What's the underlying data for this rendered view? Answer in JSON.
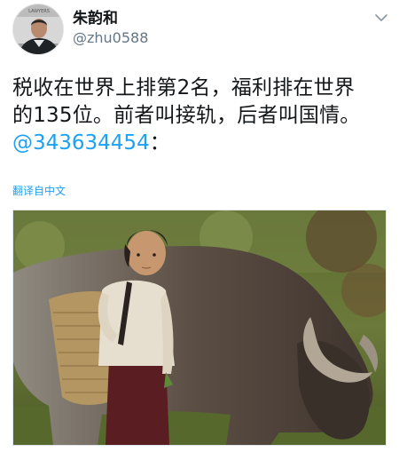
{
  "author": {
    "display_name": "朱韵和",
    "handle": "@zhu0588",
    "avatar_text": "LAWYERS"
  },
  "tweet": {
    "text_lines": [
      "税收在世界上排第2名，福利排在世界",
      "的135位。前者叫接轨，后者叫国情。"
    ],
    "mention": "@343634454",
    "mention_suffix": "：",
    "translate_label": "翻译自中文"
  },
  "media": {
    "description": "photo"
  },
  "icons": {
    "menu": "chevron-down-icon"
  }
}
